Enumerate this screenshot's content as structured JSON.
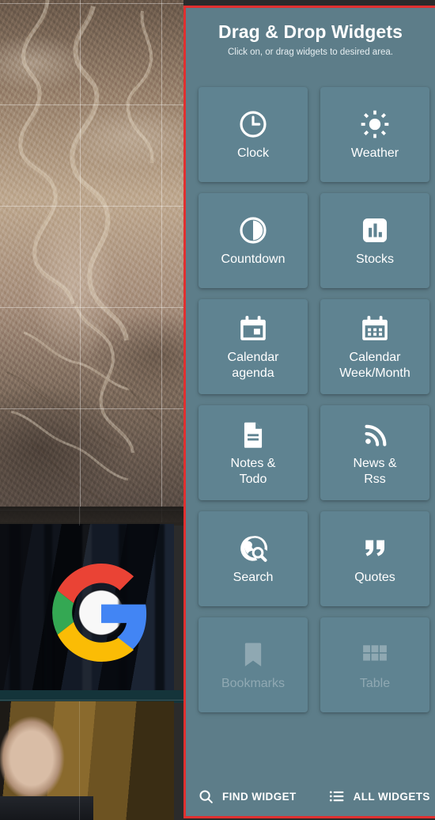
{
  "panel": {
    "title": "Drag & Drop Widgets",
    "subtitle": "Click on, or drag widgets to desired area.",
    "accent_border_color": "#e03030",
    "background_color": "#5d7d89",
    "tile_color": "#5f8391",
    "text_color": "#ffffff"
  },
  "widgets": [
    {
      "label": "Clock",
      "icon": "clock-icon"
    },
    {
      "label": "Weather",
      "icon": "sun-icon"
    },
    {
      "label": "Countdown",
      "icon": "countdown-moon-icon"
    },
    {
      "label": "Stocks",
      "icon": "bar-chart-icon"
    },
    {
      "label": "Calendar\nagenda",
      "icon": "calendar-agenda-icon"
    },
    {
      "label": "Calendar\nWeek/Month",
      "icon": "calendar-month-icon"
    },
    {
      "label": "Notes &\nTodo",
      "icon": "document-icon"
    },
    {
      "label": "News &\nRss",
      "icon": "rss-icon"
    },
    {
      "label": "Search",
      "icon": "globe-search-icon"
    },
    {
      "label": "Quotes",
      "icon": "quote-marks-icon"
    },
    {
      "label": "Bookmarks",
      "icon": "bookmark-icon"
    },
    {
      "label": "Table",
      "icon": "grid-table-icon"
    }
  ],
  "scroll_hint": {
    "icon": "chevron-down-icon"
  },
  "bottom_bar": {
    "find_widget": {
      "label": "FIND WIDGET",
      "icon": "search-icon"
    },
    "all_widgets": {
      "label": "ALL WIDGETS",
      "icon": "list-icon"
    }
  }
}
